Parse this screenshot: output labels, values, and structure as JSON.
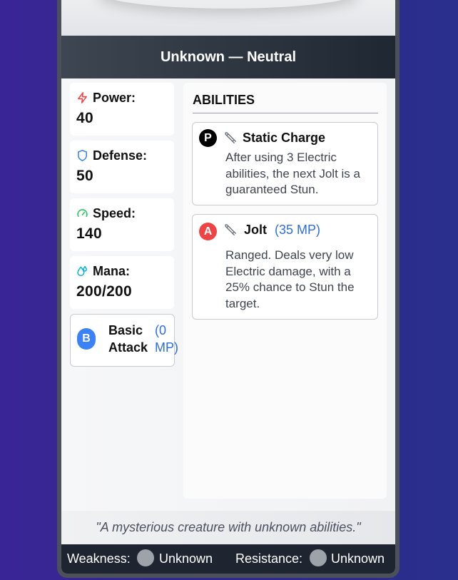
{
  "card": {
    "title": "Unknown — Neutral"
  },
  "stats": [
    {
      "label": "Power:",
      "value": "40",
      "icon": "lightning-icon",
      "color": "#ef4444"
    },
    {
      "label": "Defense:",
      "value": "50",
      "icon": "shield-icon",
      "color": "#3b82f6"
    },
    {
      "label": "Speed:",
      "value": "140",
      "icon": "speedometer-icon",
      "color": "#22c55e"
    },
    {
      "label": "Mana:",
      "value": "200/200",
      "icon": "droplet-icon",
      "color": "#06b6d4"
    }
  ],
  "basic_attack": {
    "badge": "B",
    "name": "Basic Attack",
    "cost": "(0 MP)",
    "badge_color": "#3b82f6"
  },
  "abilities": {
    "title": "ABILITIES",
    "items": [
      {
        "badge": "P",
        "badge_color": "#000000",
        "icon": "wrench-icon",
        "name": "Static Charge",
        "cost": "",
        "description": "After using 3 Electric abilities, the next Jolt is a guaranteed Stun."
      },
      {
        "badge": "A",
        "badge_color": "#ef4444",
        "icon": "wrench-icon",
        "name": "Jolt",
        "cost": "(35 MP)",
        "description": "Ranged. Deals very low Electric damage, with a 25% chance to Stun the target."
      }
    ]
  },
  "flavor_text": "\"A mysterious creature with unknown abilities.\"",
  "footer": {
    "weakness_label": "Weakness:",
    "weakness_value": "Unknown",
    "resistance_label": "Resistance:",
    "resistance_value": "Unknown"
  }
}
